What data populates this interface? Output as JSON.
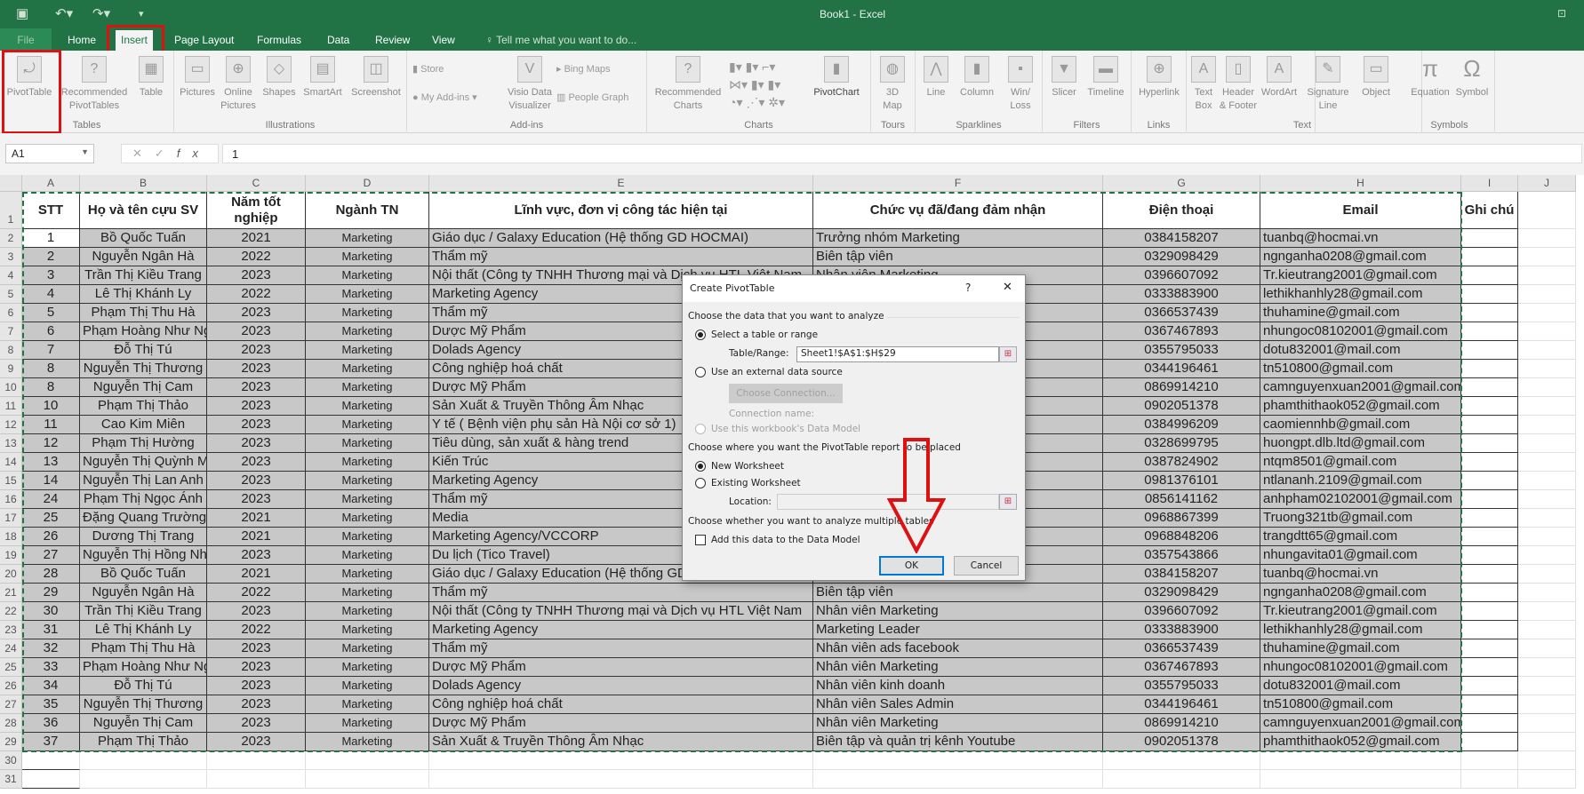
{
  "window": {
    "title": "Book1 - Excel"
  },
  "quick_access": {
    "save_icon": "save-icon",
    "undo_icon": "undo-icon",
    "redo_icon": "redo-icon",
    "customize_icon": "customize-icon"
  },
  "tabs": [
    "File",
    "Home",
    "Insert",
    "Page Layout",
    "Formulas",
    "Data",
    "Review",
    "View"
  ],
  "tell_me": "Tell me what you want to do...",
  "ribbon": {
    "groups": [
      {
        "label": "Tables",
        "buttons": [
          "PivotTable",
          "Recommended PivotTables",
          "Table"
        ]
      },
      {
        "label": "Illustrations",
        "buttons": [
          "Pictures",
          "Online Pictures",
          "Shapes",
          "SmartArt",
          "Screenshot"
        ]
      },
      {
        "label": "Add-ins",
        "buttons": [
          "Store",
          "My Add-ins",
          "Visio Data Visualizer",
          "Bing Maps",
          "People Graph"
        ]
      },
      {
        "label": "Charts",
        "buttons": [
          "Recommended Charts",
          "PivotChart"
        ]
      },
      {
        "label": "Tours",
        "buttons": [
          "3D Map"
        ]
      },
      {
        "label": "Sparklines",
        "buttons": [
          "Line",
          "Column",
          "Win/ Loss"
        ]
      },
      {
        "label": "Filters",
        "buttons": [
          "Slicer",
          "Timeline"
        ]
      },
      {
        "label": "Links",
        "buttons": [
          "Hyperlink"
        ]
      },
      {
        "label": "Text",
        "buttons": [
          "Text Box",
          "Header & Footer",
          "WordArt",
          "Signature Line",
          "Object"
        ]
      },
      {
        "label": "Symbols",
        "buttons": [
          "Equation",
          "Symbol"
        ]
      }
    ]
  },
  "formula_bar": {
    "name_box": "A1",
    "value": "1",
    "fx": "fx"
  },
  "sheet": {
    "columns": [
      "A",
      "B",
      "C",
      "D",
      "E",
      "F",
      "G",
      "H",
      "I",
      "J"
    ],
    "headers": [
      "STT",
      "Họ và tên cựu SV",
      "Năm tốt nghiệp",
      "Ngành TN",
      "Lĩnh vực, đơn vị công tác hiện tại",
      "Chức vụ đã/đang đảm nhận",
      "Điện thoại",
      "Email",
      "Ghi chú"
    ],
    "rows": [
      [
        "1",
        "Bồ Quốc Tuấn",
        "2021",
        "Marketing",
        "Giáo dục / Galaxy Education (Hệ thống GD HOCMAI)",
        "Trưởng nhóm Marketing",
        "0384158207",
        "tuanbq@hocmai.vn"
      ],
      [
        "2",
        "Nguyễn Ngân Hà",
        "2022",
        "Marketing",
        "Thẩm mỹ",
        "Biên tập viên",
        "0329098429",
        "ngnganha0208@gmail.com"
      ],
      [
        "3",
        "Trần Thị Kiều Trang",
        "2023",
        "Marketing",
        "Nội thất (Công ty TNHH Thương mại và Dịch vụ HTL Việt Nam",
        "Nhân viên Marketing",
        "0396607092",
        "Tr.kieutrang2001@gmail.com"
      ],
      [
        "4",
        "Lê Thị Khánh Ly",
        "2022",
        "Marketing",
        "Marketing Agency",
        "",
        "0333883900",
        "lethikhanhly28@gmail.com"
      ],
      [
        "5",
        "Phạm Thị Thu Hà",
        "2023",
        "Marketing",
        "Thẩm mỹ",
        "",
        "0366537439",
        "thuhamine@gmail.com"
      ],
      [
        "6",
        "Phạm Hoàng Như Ngọc",
        "2023",
        "Marketing",
        "Dược Mỹ Phẩm",
        "",
        "0367467893",
        "nhungoc08102001@gmail.com"
      ],
      [
        "7",
        "Đỗ Thị Tú",
        "2023",
        "Marketing",
        "Dolads Agency",
        "",
        "0355795033",
        "dotu832001@mail.com"
      ],
      [
        "8",
        "Nguyễn Thị Thương",
        "2023",
        "Marketing",
        "Công nghiệp hoá chất",
        "",
        "0344196461",
        "tn510800@gmail.com"
      ],
      [
        "8",
        "Nguyễn Thị Cam",
        "2023",
        "Marketing",
        "Dược Mỹ Phẩm",
        "",
        "0869914210",
        "camnguyenxuan2001@gmail.com"
      ],
      [
        "10",
        "Phạm Thị Thảo",
        "2023",
        "Marketing",
        "Sản Xuất & Truyền Thông Âm Nhạc",
        "",
        "0902051378",
        "phamthithaok052@gmail.com"
      ],
      [
        "11",
        "Cao Kim Miên",
        "2023",
        "Marketing",
        "Y tế ( Bệnh viện phụ sản Hà Nội cơ sở 1)",
        "",
        "0384996209",
        "caomiennhb@gmail.com"
      ],
      [
        "12",
        "Phạm Thị Hường",
        "2023",
        "Marketing",
        "Tiêu dùng, sản xuất & hàng trend",
        "",
        "0328699795",
        "huongpt.dlb.ltd@gmail.com"
      ],
      [
        "13",
        "Nguyễn Thị Quỳnh Mai",
        "2023",
        "Marketing",
        "Kiến Trúc",
        "",
        "0387824902",
        "ntqm8501@gmail.com"
      ],
      [
        "14",
        "Nguyễn Thị Lan Anh",
        "2023",
        "Marketing",
        "Marketing Agency",
        "",
        "0981376101",
        "ntlananh.2109@gmail.com"
      ],
      [
        "24",
        "Phạm Thị Ngọc Ánh",
        "2023",
        "Marketing",
        "Thẩm mỹ",
        "",
        "0856141162",
        "anhpham02102001@gmail.com"
      ],
      [
        "25",
        "Đặng Quang Trường",
        "2021",
        "Marketing",
        "Media",
        "",
        "0968867399",
        "Truong321tb@gmail.com"
      ],
      [
        "26",
        "Dương Thị Trang",
        "2021",
        "Marketing",
        "Marketing Agency/VCCORP",
        "",
        "0968848206",
        "trangdtt65@gmail.com"
      ],
      [
        "27",
        "Nguyễn Thị Hồng Nhung",
        "2023",
        "Marketing",
        "Du lịch (Tico Travel)",
        "",
        "0357543866",
        "nhungavita01@gmail.com"
      ],
      [
        "28",
        "Bồ Quốc Tuấn",
        "2021",
        "Marketing",
        "Giáo dục / Galaxy Education (Hệ thống GD HOCMAI)",
        "",
        "0384158207",
        "tuanbq@hocmai.vn"
      ],
      [
        "29",
        "Nguyễn Ngân Hà",
        "2022",
        "Marketing",
        "Thẩm mỹ",
        "Biên tập viên",
        "0329098429",
        "ngnganha0208@gmail.com"
      ],
      [
        "30",
        "Trần Thị Kiều Trang",
        "2023",
        "Marketing",
        "Nội thất (Công ty TNHH Thương mại và Dịch vụ HTL Việt Nam",
        "Nhân viên Marketing",
        "0396607092",
        "Tr.kieutrang2001@gmail.com"
      ],
      [
        "31",
        "Lê Thị Khánh Ly",
        "2022",
        "Marketing",
        "Marketing Agency",
        "Marketing Leader",
        "0333883900",
        "lethikhanhly28@gmail.com"
      ],
      [
        "32",
        "Phạm Thị Thu Hà",
        "2023",
        "Marketing",
        "Thẩm mỹ",
        "Nhân viên ads facebook",
        "0366537439",
        "thuhamine@gmail.com"
      ],
      [
        "33",
        "Phạm Hoàng Như Ngọc",
        "2023",
        "Marketing",
        "Dược Mỹ Phẩm",
        "Nhân viên Marketing",
        "0367467893",
        "nhungoc08102001@gmail.com"
      ],
      [
        "34",
        "Đỗ Thị Tú",
        "2023",
        "Marketing",
        "Dolads Agency",
        "Nhân viên kinh doanh",
        "0355795033",
        "dotu832001@mail.com"
      ],
      [
        "35",
        "Nguyễn Thị Thương",
        "2023",
        "Marketing",
        "Công nghiệp hoá chất",
        "Nhân viên Sales Admin",
        "0344196461",
        "tn510800@gmail.com"
      ],
      [
        "36",
        "Nguyễn Thị Cam",
        "2023",
        "Marketing",
        "Dược Mỹ Phẩm",
        "Nhân viên Marketing",
        "0869914210",
        "camnguyenxuan2001@gmail.com"
      ],
      [
        "37",
        "Phạm Thị Thảo",
        "2023",
        "Marketing",
        "Sản Xuất & Truyền Thông Âm Nhạc",
        "Biên tập và quản trị kênh Youtube",
        "0902051378",
        "phamthithaok052@gmail.com"
      ]
    ],
    "extra_row_numbers": [
      "30",
      "31"
    ]
  },
  "dialog": {
    "title": "Create PivotTable",
    "help": "?",
    "close": "✕",
    "section1": "Choose the data that you want to analyze",
    "opt_select_range": "Select a table or range",
    "table_range_label": "Table/Range:",
    "table_range_value": "Sheet1!$A$1:$H$29",
    "opt_external": "Use an external data source",
    "choose_connection": "Choose Connection...",
    "connection_name": "Connection name:",
    "opt_data_model": "Use this workbook's Data Model",
    "section2": "Choose where you want the PivotTable report to be placed",
    "opt_new_ws": "New Worksheet",
    "opt_existing_ws": "Existing Worksheet",
    "location_label": "Location:",
    "location_value": "",
    "section3": "Choose whether you want to analyze multiple tables",
    "add_data_model": "Add this data to the Data Model",
    "add_data_model_checked": false,
    "selected_source": "Select a table or range",
    "selected_destination": "New Worksheet",
    "ok": "OK",
    "cancel": "Cancel"
  },
  "colors": {
    "excel_green": "#217346",
    "highlight_red": "#dd1111",
    "selection_gray": "#c8c8c8"
  }
}
